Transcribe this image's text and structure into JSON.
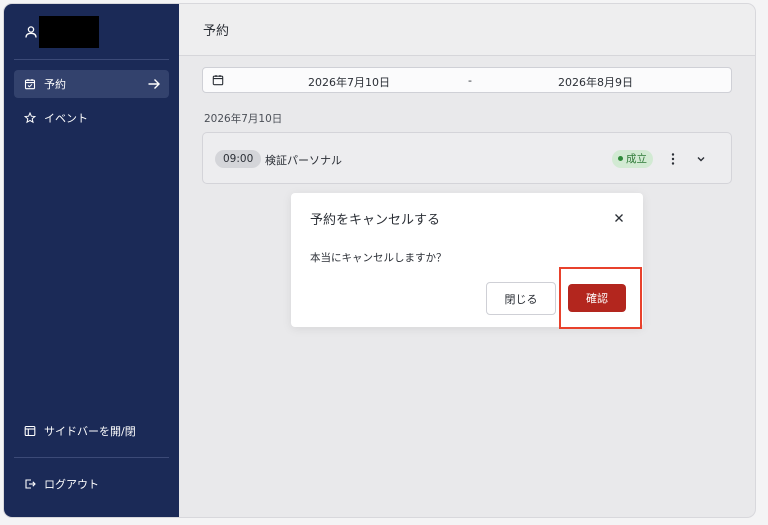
{
  "sidebar": {
    "items": [
      {
        "label": "予約",
        "icon": "calendar-check-icon",
        "active": true
      },
      {
        "label": "イベント",
        "icon": "star-icon",
        "active": false
      }
    ],
    "toggle_label": "サイドバーを開/閉",
    "logout_label": "ログアウト"
  },
  "header": {
    "title": "予約"
  },
  "filters": {
    "start_date": "2026年7月10日",
    "separator": "-",
    "end_date": "2026年8月9日"
  },
  "groups": [
    {
      "date_label": "2026年7月10日",
      "events": [
        {
          "time": "09:00",
          "title": "検証パーソナル",
          "status": "成立"
        }
      ]
    }
  ],
  "modal": {
    "title": "予約をキャンセルする",
    "message": "本当にキャンセルしますか？",
    "close_label": "閉じる",
    "confirm_label": "確認"
  },
  "colors": {
    "sidebar_bg": "#1b2a57",
    "confirm_bg": "#b3261e",
    "status_green": "#2f7a38",
    "highlight": "#e8412c"
  }
}
